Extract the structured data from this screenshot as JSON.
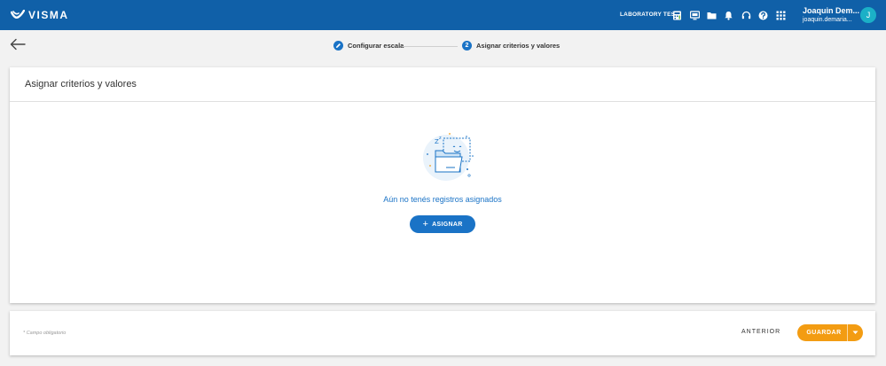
{
  "header": {
    "brand": "VISMA",
    "environment": "LABORATORY TEST",
    "user_name": "Joaquin Dem...",
    "user_email": "joaquin.demaria...",
    "avatar_initial": "J",
    "icons": [
      "calculator-icon",
      "monitor-icon",
      "folder-icon",
      "bell-icon",
      "headset-icon",
      "help-icon",
      "apps-grid-icon"
    ]
  },
  "stepper": {
    "steps": [
      {
        "label": "Configurar escala",
        "state": "completed",
        "icon": "pencil-icon"
      },
      {
        "label": "Asignar criterios y valores",
        "state": "active",
        "number": "2"
      }
    ]
  },
  "main": {
    "title": "Asignar criterios y valores",
    "empty_message": "Aún no tenés registros asignados",
    "assign_label": "ASIGNAR"
  },
  "footer": {
    "required_note": "* Campo obligatorio",
    "previous_label": "ANTERIOR",
    "save_label": "GUARDAR"
  },
  "colors": {
    "topbar": "#1060a8",
    "primary": "#1a73c6",
    "accent": "#f39c12",
    "avatar": "#1bb0c7"
  }
}
